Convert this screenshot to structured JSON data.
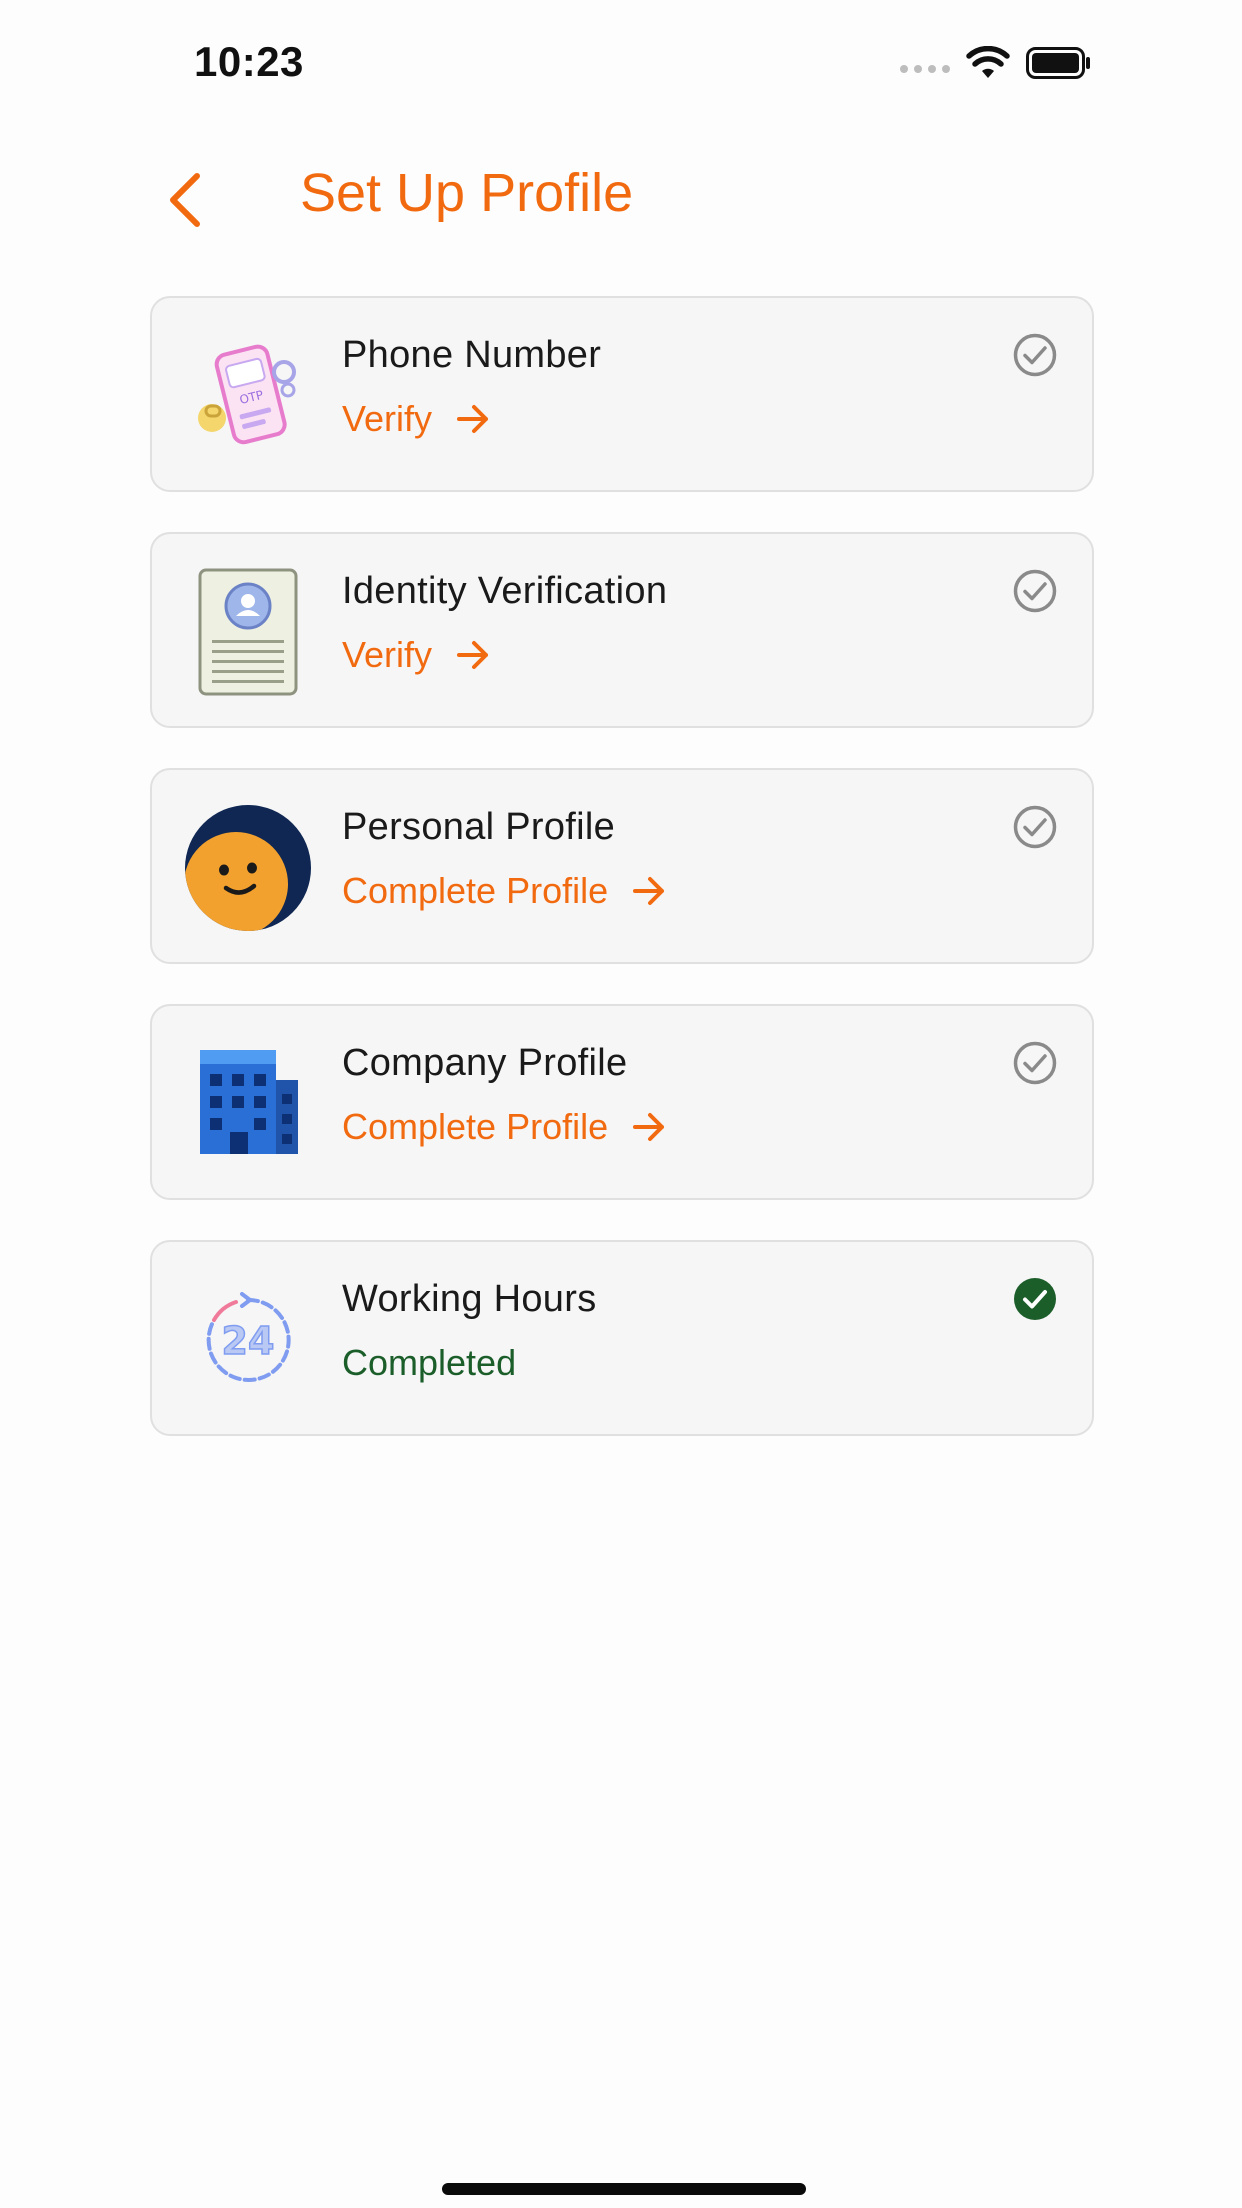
{
  "status_bar": {
    "time": "10:23",
    "icons": [
      "signal-dots-icon",
      "wifi-icon",
      "battery-icon"
    ]
  },
  "header": {
    "back_icon": "chevron-left-icon",
    "title": "Set Up Profile"
  },
  "colors": {
    "accent": "#f26a10",
    "completed": "#1b5e2a",
    "card_bg": "#f6f6f6",
    "card_border": "#e0e0e0",
    "pending_check": "#8a8a8a"
  },
  "items": [
    {
      "title": "Phone Number",
      "action": "Verify",
      "status": "pending",
      "icon": "phone-verification-icon"
    },
    {
      "title": "Identity Verification",
      "action": "Verify",
      "status": "pending",
      "icon": "id-card-icon"
    },
    {
      "title": "Personal Profile",
      "action": "Complete Profile",
      "status": "pending",
      "icon": "avatar-icon"
    },
    {
      "title": "Company Profile",
      "action": "Complete Profile",
      "status": "pending",
      "icon": "building-icon"
    },
    {
      "title": "Working Hours",
      "action": "Completed",
      "status": "completed",
      "icon": "clock-24-icon"
    }
  ]
}
